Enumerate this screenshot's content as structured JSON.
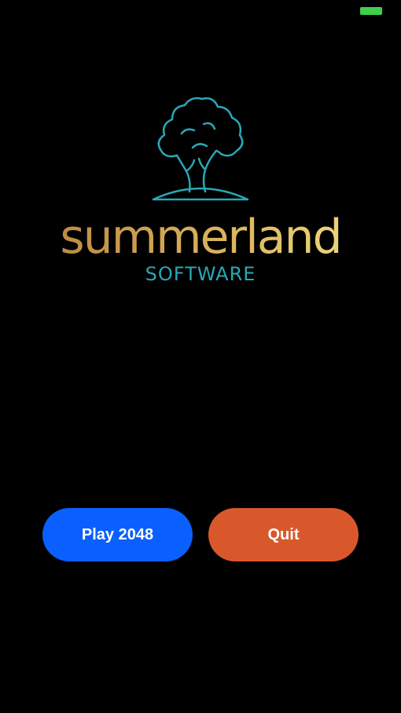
{
  "status_bar": {
    "battery_icon": "battery-icon",
    "battery_color": "#3ecf4c"
  },
  "logo": {
    "icon": "tree-icon",
    "name": "summerland",
    "subtitle": "SOFTWARE",
    "icon_color": "#2aa7b6",
    "subtitle_color": "#2aa7b6"
  },
  "actions": {
    "play_label": "Play 2048",
    "play_color": "#0a60fe",
    "quit_label": "Quit",
    "quit_color": "#d9582b"
  }
}
